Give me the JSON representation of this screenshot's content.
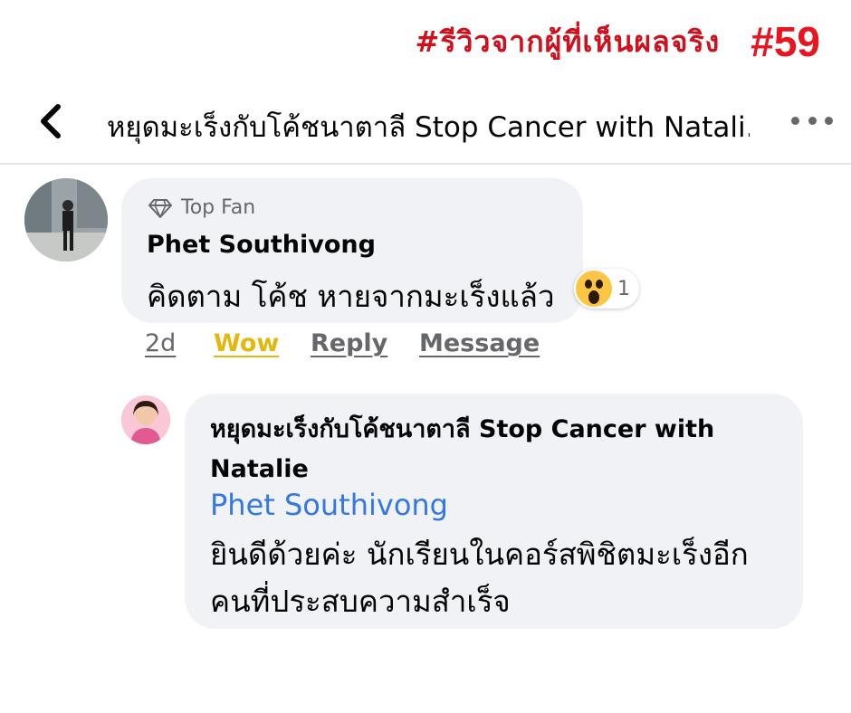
{
  "banner": {
    "text": "#รีวิวจากผู้ที่เห็นผลจริง",
    "number": "#59"
  },
  "header": {
    "title": "หยุดมะเร็งกับโค้ชนาตาลี Stop Cancer with Natali...",
    "back_icon": "chevron-left-icon",
    "more_icon": "more-horizontal-icon"
  },
  "comment": {
    "badge": "Top Fan",
    "badge_icon": "diamond-icon",
    "author": "Phet Southivong",
    "text": "คิดตาม โค้ช หายจากมะเร็งแล้ว",
    "reaction": {
      "icon": "wow-emoji-icon",
      "count": "1"
    },
    "actions": {
      "time": "2d",
      "wow": "Wow",
      "reply": "Reply",
      "message": "Message"
    }
  },
  "reply": {
    "author": "หยุดมะเร็งกับโค้ชนาตาลี Stop Cancer with Natalie",
    "mention": "Phet Southivong",
    "text": "ยินดีด้วยค่ะ นักเรียนในคอร์สพิชิตมะเร็งอีก คนที่ประสบความสำเร็จ"
  },
  "colors": {
    "banner": "#d0101d",
    "wow_active": "#e3b80e",
    "mention": "#3578e5",
    "bubble": "#f0f2f5",
    "secondary_text": "#65676b"
  }
}
